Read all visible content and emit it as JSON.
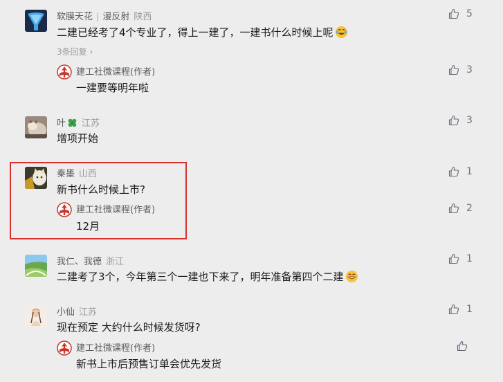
{
  "comments": [
    {
      "author": "软膜天花",
      "author_extra": "漫反射",
      "location": "陕西",
      "text": "二建已经考了4个专业了，得上一建了，一建书什么时候上呢",
      "emoji": "laugh-tears-emoji",
      "likes": "5",
      "replies_link": "3条回复",
      "reply": {
        "author": "建工社微课程(作者)",
        "text": "一建要等明年啦",
        "likes": "3"
      }
    },
    {
      "author": "叶",
      "location": "江苏",
      "text": "增项开始",
      "likes": "3"
    },
    {
      "author": "秦墨",
      "location": "山西",
      "text": "新书什么时候上市?",
      "likes": "1",
      "reply": {
        "author": "建工社微课程(作者)",
        "text": "12月",
        "likes": "2"
      }
    },
    {
      "author": "我仁、我德",
      "location": "浙江",
      "text": "二建考了3个，今年第三个一建也下来了，明年准备第四个二建",
      "emoji": "grin-emoji",
      "likes": "1"
    },
    {
      "author": "小仙",
      "location": "江苏",
      "text": "现在预定 大约什么时候发货呀?",
      "likes": "1",
      "reply": {
        "author": "建工社微课程(作者)",
        "text": "新书上市后预售订单会优先发货",
        "likes": ""
      }
    }
  ],
  "colors": {
    "background": "#ededed",
    "highlight_border": "#d9302c",
    "author_logo": "#c8372d"
  }
}
